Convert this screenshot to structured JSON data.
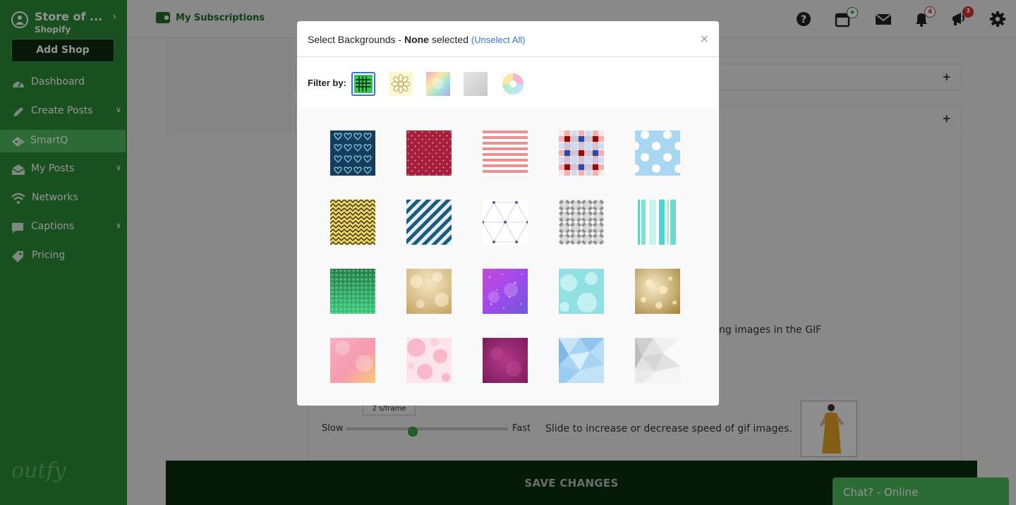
{
  "sidebar": {
    "store_name": "Store of ...",
    "store_platform": "Shopify",
    "add_shop_label": "Add Shop",
    "items": [
      {
        "label": "Dashboard",
        "icon": "dashboard-icon"
      },
      {
        "label": "Create Posts",
        "icon": "pencil-icon"
      },
      {
        "label": "SmartQ",
        "icon": "smartq-icon"
      },
      {
        "label": "My Posts",
        "icon": "envelope-icon"
      },
      {
        "label": "Networks",
        "icon": "wifi-icon"
      },
      {
        "label": "Captions",
        "icon": "comment-icon"
      },
      {
        "label": "Pricing",
        "icon": "tag-icon"
      }
    ],
    "logo_text": "outfy",
    "accent_color": "#2b8a36",
    "active_color": "#4fb85e"
  },
  "topbar": {
    "subscriptions_label": "My Subscriptions",
    "notifications_count": "4",
    "announcements_count": "3"
  },
  "content": {
    "gif_text": "ng images in the GIF",
    "slow_label": "Slow",
    "fast_label": "Fast",
    "frame_tip": "2 s/frame",
    "speed_description": "Slide to increase or decrease speed of gif images.",
    "save_label": "SAVE CHANGES",
    "chat_label": "Chat? - Online"
  },
  "modal": {
    "title_prefix": "Select Backgrounds - ",
    "title_bold": "None",
    "title_suffix": " selected ",
    "unselect_label": "(Unselect All)",
    "close_label": "×",
    "filter_label": "Filter by:",
    "filters": [
      {
        "name": "pattern-filter",
        "icon": "grid-icon",
        "active": true
      },
      {
        "name": "floral-filter",
        "icon": "flower-icon",
        "active": false
      },
      {
        "name": "gradient-filter",
        "icon": "gradient-icon",
        "active": false
      },
      {
        "name": "texture-filter",
        "icon": "gray-texture-icon",
        "active": false
      },
      {
        "name": "color-filter",
        "icon": "color-wheel-icon",
        "active": false
      }
    ],
    "backgrounds": [
      "hearts-pattern",
      "polka-dots-red",
      "stripes-pink",
      "gingham-red-blue",
      "polka-dots-blue",
      "chevron-yellow",
      "diagonal-stripes-blue",
      "geometric-triangles",
      "diamonds-gray",
      "stripes-turquoise",
      "bokeh-green",
      "bokeh-gold-light",
      "bokeh-purple",
      "bokeh-aqua",
      "bokeh-gold",
      "watercolor-peach",
      "bubbles-pink",
      "texture-magenta",
      "polygon-blue",
      "polygon-gray"
    ]
  }
}
